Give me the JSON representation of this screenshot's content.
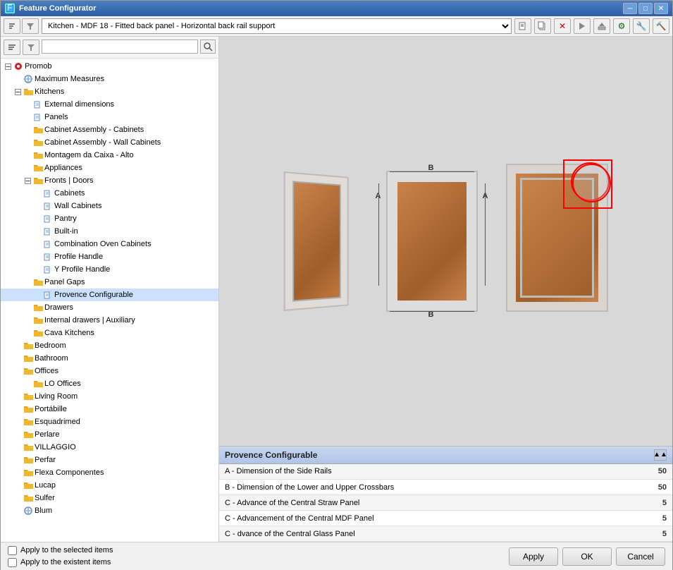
{
  "window": {
    "title": "Feature Configurator",
    "icon": "FC"
  },
  "titlebar": {
    "min": "─",
    "max": "□",
    "close": "✕"
  },
  "toolbar": {
    "dropdown_value": "Kitchen - MDF 18 - Fitted back panel - Horizontal back rail support",
    "buttons": [
      "⬛",
      "⬛",
      "✕",
      "▶",
      "⬛",
      "⚙",
      "🔧",
      "🔨"
    ]
  },
  "search": {
    "placeholder": "",
    "search_icon": "🔍"
  },
  "tree": {
    "items": [
      {
        "id": "promob",
        "label": "Promob",
        "level": 0,
        "expanded": true,
        "type": "root",
        "icon": "red-circle"
      },
      {
        "id": "max-measures",
        "label": "Maximum Measures",
        "level": 1,
        "type": "leaf",
        "icon": "leaf"
      },
      {
        "id": "kitchens",
        "label": "Kitchens",
        "level": 1,
        "expanded": true,
        "type": "folder"
      },
      {
        "id": "external-dim",
        "label": "External dimensions",
        "level": 2,
        "type": "leaf"
      },
      {
        "id": "panels",
        "label": "Panels",
        "level": 2,
        "type": "leaf"
      },
      {
        "id": "cab-assembly",
        "label": "Cabinet Assembly - Cabinets",
        "level": 2,
        "type": "folder"
      },
      {
        "id": "cab-wall",
        "label": "Cabinet Assembly - Wall Cabinets",
        "level": 2,
        "type": "folder"
      },
      {
        "id": "montagem",
        "label": "Montagem da Caixa - Alto",
        "level": 2,
        "type": "folder"
      },
      {
        "id": "appliances",
        "label": "Appliances",
        "level": 2,
        "type": "folder"
      },
      {
        "id": "fronts-doors",
        "label": "Fronts | Doors",
        "level": 2,
        "expanded": true,
        "type": "folder"
      },
      {
        "id": "cabinets",
        "label": "Cabinets",
        "level": 3,
        "type": "leaf"
      },
      {
        "id": "wall-cabinets",
        "label": "Wall Cabinets",
        "level": 3,
        "type": "leaf"
      },
      {
        "id": "pantry",
        "label": "Pantry",
        "level": 3,
        "type": "leaf"
      },
      {
        "id": "built-in",
        "label": "Built-in",
        "level": 3,
        "type": "leaf"
      },
      {
        "id": "combo-oven",
        "label": "Combination Oven Cabinets",
        "level": 3,
        "type": "leaf"
      },
      {
        "id": "profile-handle",
        "label": "Profile Handle",
        "level": 3,
        "type": "leaf"
      },
      {
        "id": "y-profile",
        "label": "Y Profile Handle",
        "level": 3,
        "type": "leaf"
      },
      {
        "id": "panel-gaps",
        "label": "Panel Gaps",
        "level": 2,
        "type": "folder"
      },
      {
        "id": "provence",
        "label": "Provence Configurable",
        "level": 3,
        "type": "leaf",
        "selected": true
      },
      {
        "id": "drawers",
        "label": "Drawers",
        "level": 2,
        "type": "folder"
      },
      {
        "id": "internal-drawers",
        "label": "Internal drawers | Auxiliary",
        "level": 2,
        "type": "folder"
      },
      {
        "id": "cava-kitchens",
        "label": "Cava Kitchens",
        "level": 2,
        "type": "folder"
      },
      {
        "id": "bedroom",
        "label": "Bedroom",
        "level": 1,
        "type": "folder"
      },
      {
        "id": "bathroom",
        "label": "Bathroom",
        "level": 1,
        "type": "folder"
      },
      {
        "id": "offices",
        "label": "Offices",
        "level": 1,
        "type": "folder"
      },
      {
        "id": "lo-offices",
        "label": "LO Offices",
        "level": 2,
        "type": "folder"
      },
      {
        "id": "living-room",
        "label": "Living Room",
        "level": 1,
        "type": "folder"
      },
      {
        "id": "portabille",
        "label": "Portábille",
        "level": 1,
        "type": "folder"
      },
      {
        "id": "esquadrimed",
        "label": "Esquadrimed",
        "level": 1,
        "type": "folder"
      },
      {
        "id": "perlare",
        "label": "Perlare",
        "level": 1,
        "type": "folder"
      },
      {
        "id": "villaggio",
        "label": "VILLAGGIO",
        "level": 1,
        "type": "folder"
      },
      {
        "id": "perfar",
        "label": "Perfar",
        "level": 1,
        "type": "folder"
      },
      {
        "id": "flexa",
        "label": "Flexa Componentes",
        "level": 1,
        "type": "folder"
      },
      {
        "id": "lucap",
        "label": "Lucap",
        "level": 1,
        "type": "folder"
      },
      {
        "id": "sulfer",
        "label": "Sulfer",
        "level": 1,
        "type": "folder"
      },
      {
        "id": "blum",
        "label": "Blum",
        "level": 1,
        "type": "leaf"
      }
    ]
  },
  "properties": {
    "title": "Provence Configurable",
    "rows": [
      {
        "label": "A - Dimension of the Side Rails",
        "value": "50"
      },
      {
        "label": "B - Dimension of the Lower and Upper Crossbars",
        "value": "50"
      },
      {
        "label": "C - Advance of the Central Straw Panel",
        "value": "5"
      },
      {
        "label": "C - Advancement of the Central MDF Panel",
        "value": "5"
      },
      {
        "label": "C - dvance of the Central Glass Panel",
        "value": "5"
      }
    ]
  },
  "bottom": {
    "checkbox1_label": "Apply to the selected items",
    "checkbox2_label": "Apply to the existent items",
    "btn_apply": "Apply",
    "btn_ok": "OK",
    "btn_cancel": "Cancel"
  }
}
